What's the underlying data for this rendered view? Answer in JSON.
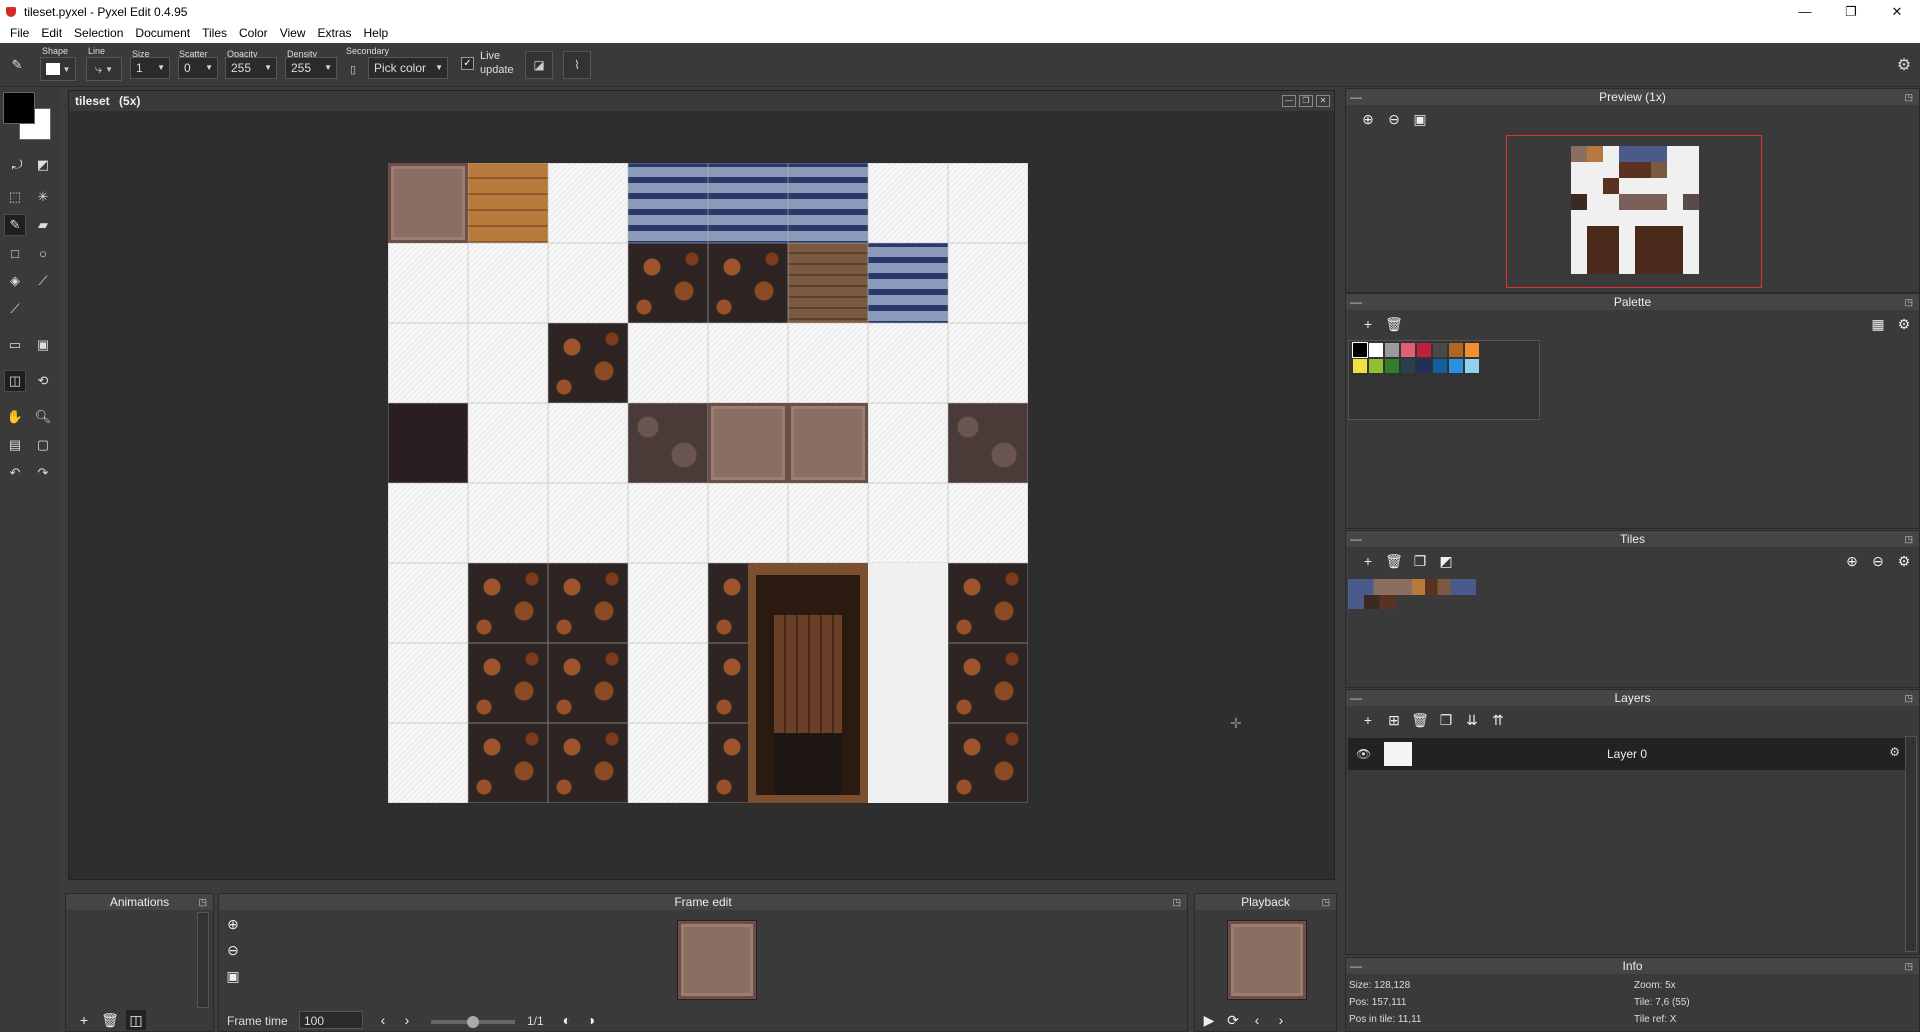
{
  "window": {
    "title": "tileset.pyxel - Pyxel Edit 0.4.95",
    "minimize": "—",
    "maximize": "❐",
    "close": "✕"
  },
  "menu": [
    "File",
    "Edit",
    "Selection",
    "Document",
    "Tiles",
    "Color",
    "View",
    "Extras",
    "Help"
  ],
  "options": {
    "shape_label": "Shape",
    "line_label": "Line",
    "size_label": "Size",
    "size_value": "1",
    "scatter_label": "Scatter",
    "scatter_value": "0",
    "opacity_label": "Opacity",
    "opacity_value": "255",
    "density_label": "Density",
    "density_value": "255",
    "secondary_label": "Secondary",
    "secondary_value": "Pick color",
    "live_update_label_1": "Live",
    "live_update_label_2": "update",
    "live_update_checked": true
  },
  "document": {
    "title": "tileset",
    "zoom_label": "(5x)"
  },
  "panels": {
    "preview": {
      "title": "Preview (1x)"
    },
    "palette": {
      "title": "Palette",
      "colors": [
        "#000000",
        "#ffffff",
        "#9a9a9a",
        "#e0607a",
        "#c0203a",
        "#4a4a4a",
        "#b06820",
        "#f09030",
        "#f0e040",
        "#90c030",
        "#30802a",
        "#284050",
        "#20305a",
        "#1060a0",
        "#3090e0",
        "#90d0f0"
      ]
    },
    "tiles": {
      "title": "Tiles"
    },
    "layers": {
      "title": "Layers",
      "items": [
        {
          "name": "Layer 0",
          "visible": true
        }
      ]
    },
    "info": {
      "title": "Info",
      "size": "Size: 128,128",
      "pos": "Pos: 157,111",
      "pos_in_tile": "Pos in tile: 11,11",
      "zoom": "Zoom: 5x",
      "tile": "Tile: 7,6 (55)",
      "tile_ref": "Tile ref: X"
    },
    "animations": {
      "title": "Animations"
    },
    "frame_edit": {
      "title": "Frame edit",
      "frame_time_label": "Frame time",
      "frame_time_value": "100",
      "frame_counter": "1/1"
    },
    "playback": {
      "title": "Playback"
    }
  },
  "canvas_tiles": [
    [
      "plate",
      "wood",
      "empty",
      "brick",
      "brick",
      "brick",
      "empty",
      "empty"
    ],
    [
      "empty",
      "empty",
      "empty",
      "rock",
      "rock",
      "plank",
      "brick",
      "empty"
    ],
    [
      "empty",
      "empty",
      "rock",
      "empty",
      "empty",
      "empty",
      "empty",
      "empty"
    ],
    [
      "dark",
      "empty",
      "empty",
      "cobble",
      "plate",
      "plate",
      "empty",
      "cobble"
    ],
    [
      "empty",
      "empty",
      "empty",
      "empty",
      "empty",
      "empty",
      "empty",
      "empty"
    ],
    [
      "empty",
      "rock",
      "rock",
      "empty",
      "rock",
      "door",
      "door",
      "rock"
    ],
    [
      "empty",
      "rock",
      "rock",
      "empty",
      "rock",
      "door",
      "door",
      "rock"
    ],
    [
      "empty",
      "rock",
      "rock",
      "empty",
      "rock",
      "door",
      "door",
      "rock"
    ]
  ]
}
